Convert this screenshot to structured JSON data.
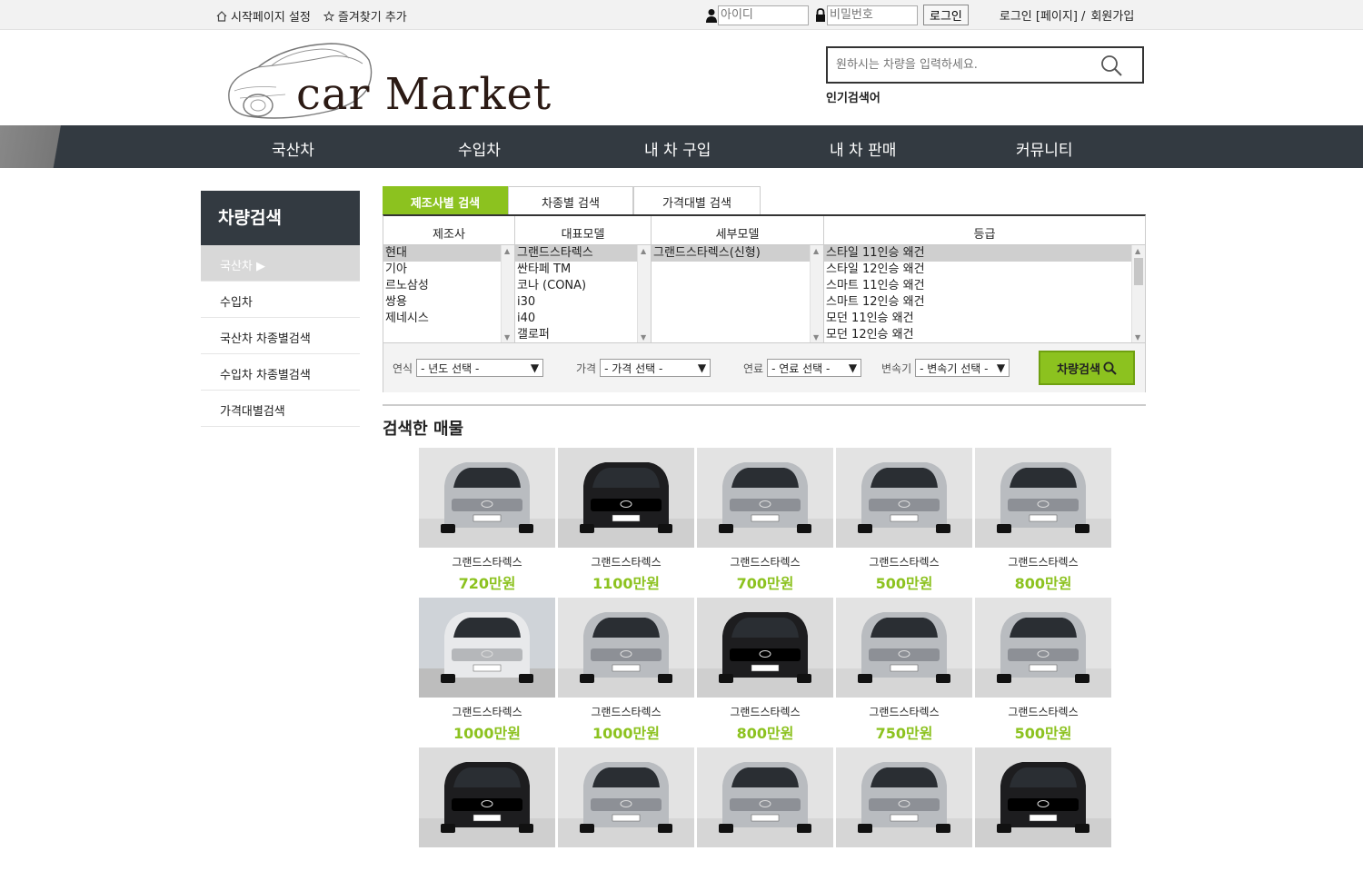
{
  "topbar": {
    "start_page": "시작페이지 설정",
    "favorites": "즐겨찾기 추가",
    "id_placeholder": "아이디",
    "pw_placeholder": "비밀번호",
    "login_button": "로그인",
    "login_page": "로그인 [페이지] /",
    "signup": "회원가입"
  },
  "header": {
    "brand": "car Market",
    "search_placeholder": "원하시는 차량을 입력하세요.",
    "popular": "인기검색어"
  },
  "nav": [
    "국산차",
    "수입차",
    "내 차 구입",
    "내 차 판매",
    "커뮤니티"
  ],
  "sidebar": {
    "title": "차량검색",
    "items": [
      "국산차 ▶",
      "수입차",
      "국산차 차종별검색",
      "수입차 차종별검색",
      "가격대별검색"
    ]
  },
  "search_tabs": [
    "제조사별 검색",
    "차종별 검색",
    "가격대별 검색"
  ],
  "columns": [
    "제조사",
    "대표모델",
    "세부모델",
    "등급"
  ],
  "lists": {
    "maker": [
      "현대",
      "기아",
      "르노삼성",
      "쌍용",
      "제네시스"
    ],
    "model": [
      "그랜드스타렉스",
      "싼타페 TM",
      "코나 (CONA)",
      "i30",
      "i40",
      "갤로퍼"
    ],
    "submodel": [
      "그랜드스타렉스(신형)"
    ],
    "grade": [
      "스타일 11인승 왜건",
      "스타일 12인승 왜건",
      "스마트 11인승 왜건",
      "스마트 12인승 왜건",
      "모던 11인승 왜건",
      "모던 12인승 왜건"
    ]
  },
  "filters": {
    "year_label": "연식",
    "year_value": "- 년도 선택 -",
    "price_label": "가격",
    "price_value": "- 가격 선택 -",
    "fuel_label": "연료",
    "fuel_value": "- 연료 선택 -",
    "trans_label": "변속기",
    "trans_value": "- 변속기 선택 -",
    "search_button": "차량검색"
  },
  "results_title": "검색한 매물",
  "cars": [
    {
      "name": "그랜드스타렉스",
      "price": "720만원",
      "color": "silver"
    },
    {
      "name": "그랜드스타렉스",
      "price": "1100만원",
      "color": "black"
    },
    {
      "name": "그랜드스타렉스",
      "price": "700만원",
      "color": "silver"
    },
    {
      "name": "그랜드스타렉스",
      "price": "500만원",
      "color": "silver"
    },
    {
      "name": "그랜드스타렉스",
      "price": "800만원",
      "color": "silver"
    },
    {
      "name": "그랜드스타렉스",
      "price": "1000만원",
      "color": "white"
    },
    {
      "name": "그랜드스타렉스",
      "price": "1000만원",
      "color": "silver"
    },
    {
      "name": "그랜드스타렉스",
      "price": "800만원",
      "color": "black"
    },
    {
      "name": "그랜드스타렉스",
      "price": "750만원",
      "color": "silver"
    },
    {
      "name": "그랜드스타렉스",
      "price": "500만원",
      "color": "silver"
    },
    {
      "name": "",
      "price": "",
      "color": "black"
    },
    {
      "name": "",
      "price": "",
      "color": "silver"
    },
    {
      "name": "",
      "price": "",
      "color": "silver"
    },
    {
      "name": "",
      "price": "",
      "color": "silver"
    },
    {
      "name": "",
      "price": "",
      "color": "black"
    }
  ]
}
